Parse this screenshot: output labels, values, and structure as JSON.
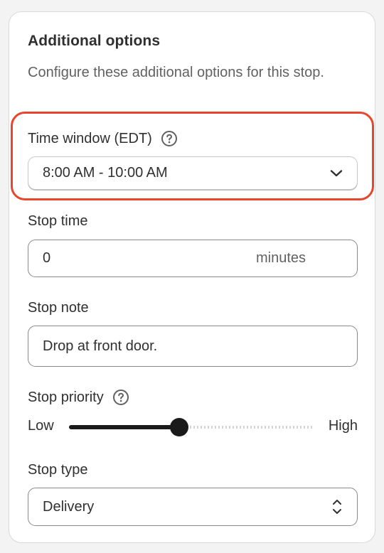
{
  "panel": {
    "title": "Additional options",
    "subtitle": "Configure these additional options for this stop."
  },
  "time_window": {
    "label": "Time window (EDT)",
    "value": "8:00 AM - 10:00 AM",
    "help_icon": "help-circle-icon",
    "chevron_icon": "chevron-down-icon",
    "highlighted": true,
    "highlight_color": "#e8452c"
  },
  "stop_time": {
    "label": "Stop time",
    "value": "0",
    "suffix": "minutes"
  },
  "stop_note": {
    "label": "Stop note",
    "value": "Drop at front door."
  },
  "stop_priority": {
    "label": "Stop priority",
    "help_icon": "help-circle-icon",
    "low_label": "Low",
    "high_label": "High",
    "value_fraction": 0.45
  },
  "stop_type": {
    "label": "Stop type",
    "value": "Delivery",
    "icon": "select-arrows-icon"
  }
}
